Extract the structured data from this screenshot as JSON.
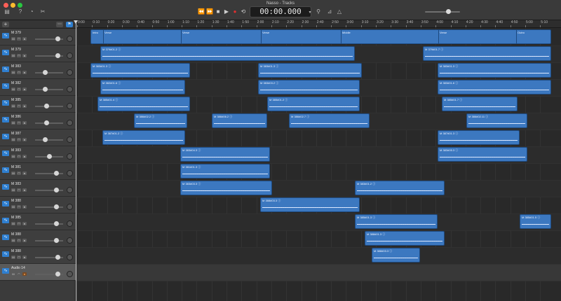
{
  "window": {
    "title": "Nasso - Tracks"
  },
  "toolbar": {
    "time_display": "00:00.000",
    "icons": [
      "library-icon",
      "help-icon",
      "smart-controls-icon",
      "editors-icon",
      "tuner-icon",
      "metronome-icon",
      "count-in-icon",
      "master-volume-icon"
    ],
    "transport": {
      "rewind": "⏪",
      "forward": "⏩",
      "stop": "■",
      "play": "▶",
      "record": "●",
      "cycle": "⟲"
    },
    "master_volume": 0.6
  },
  "headers": {
    "add_label": "+",
    "track_options": "⋯",
    "filter": "⚑"
  },
  "ruler": {
    "labels": [
      "0:00",
      "0:10",
      "0:20",
      "0:30",
      "0:40",
      "0:50",
      "1:00",
      "1:10",
      "1:20",
      "1:30",
      "1:40",
      "1:50",
      "2:00",
      "2:10",
      "2:20",
      "2:30",
      "2:40",
      "2:50",
      "3:00",
      "3:10",
      "3:20",
      "3:30",
      "3:40",
      "3:50",
      "4:00",
      "4:10",
      "4:20",
      "4:30",
      "4:40",
      "4:50",
      "5:00",
      "5:10"
    ]
  },
  "tracks": [
    {
      "name": "M 379",
      "volume": 0.8,
      "selected": false
    },
    {
      "name": "M 379",
      "volume": 0.8,
      "selected": false
    },
    {
      "name": "M 383",
      "volume": 0.35,
      "selected": false
    },
    {
      "name": "M 382",
      "volume": 0.35,
      "selected": false
    },
    {
      "name": "M 385",
      "volume": 0.4,
      "selected": false
    },
    {
      "name": "M 386",
      "volume": 0.4,
      "selected": false
    },
    {
      "name": "M 387",
      "volume": 0.35,
      "selected": false
    },
    {
      "name": "M 383",
      "volume": 0.5,
      "selected": false
    },
    {
      "name": "M 381",
      "volume": 0.75,
      "selected": false
    },
    {
      "name": "M 383",
      "volume": 0.75,
      "selected": false
    },
    {
      "name": "M 388",
      "volume": 0.75,
      "selected": false
    },
    {
      "name": "M 385",
      "volume": 0.75,
      "selected": false
    },
    {
      "name": "M 388",
      "volume": 0.75,
      "selected": false
    },
    {
      "name": "M 388",
      "volume": 0.8,
      "selected": false
    },
    {
      "name": "Audio 14",
      "volume": 0.8,
      "selected": true
    }
  ],
  "regions": [
    {
      "track": 0,
      "start": 0.03,
      "end": 0.215,
      "name": "Intro",
      "sections": [
        "Intro",
        "Verse",
        "Verse",
        "Verse",
        "Middle",
        "Verse",
        "Outro"
      ]
    },
    {
      "track": 1,
      "start": 0.05,
      "end": 0.575,
      "name": "M 379#01.2"
    },
    {
      "track": 1,
      "start": 0.715,
      "end": 0.98,
      "name": "M 379#01.7"
    },
    {
      "track": 2,
      "start": 0.03,
      "end": 0.235,
      "name": "M 383#01.3"
    },
    {
      "track": 2,
      "start": 0.375,
      "end": 0.59,
      "name": "M 383#01.3"
    },
    {
      "track": 2,
      "start": 0.745,
      "end": 0.98,
      "name": "M 383#01.3"
    },
    {
      "track": 3,
      "start": 0.05,
      "end": 0.225,
      "name": "M 382#01.6"
    },
    {
      "track": 3,
      "start": 0.375,
      "end": 0.585,
      "name": "M 383#03.2"
    },
    {
      "track": 3,
      "start": 0.745,
      "end": 0.98,
      "name": "M 383#01.6"
    },
    {
      "track": 4,
      "start": 0.045,
      "end": 0.235,
      "name": "M 385#01.4"
    },
    {
      "track": 4,
      "start": 0.395,
      "end": 0.585,
      "name": "M 385#01.2"
    },
    {
      "track": 4,
      "start": 0.755,
      "end": 0.91,
      "name": "M 385#01.7"
    },
    {
      "track": 5,
      "start": 0.12,
      "end": 0.23,
      "name": "M 386#02.2"
    },
    {
      "track": 5,
      "start": 0.28,
      "end": 0.395,
      "name": "M 386#06.2"
    },
    {
      "track": 5,
      "start": 0.44,
      "end": 0.605,
      "name": "M 386#02.7"
    },
    {
      "track": 5,
      "start": 0.805,
      "end": 0.93,
      "name": "M 386#02.11"
    },
    {
      "track": 6,
      "start": 0.055,
      "end": 0.225,
      "name": "M 387#01.2"
    },
    {
      "track": 6,
      "start": 0.745,
      "end": 0.915,
      "name": "M 387#01.3"
    },
    {
      "track": 7,
      "start": 0.215,
      "end": 0.4,
      "name": "M 383#04.3"
    },
    {
      "track": 7,
      "start": 0.745,
      "end": 0.93,
      "name": "M 383#05.3"
    },
    {
      "track": 8,
      "start": 0.215,
      "end": 0.4,
      "name": "M 381#01.3"
    },
    {
      "track": 9,
      "start": 0.215,
      "end": 0.405,
      "name": "M 383#03.3"
    },
    {
      "track": 9,
      "start": 0.575,
      "end": 0.76,
      "name": "M 383#01.2"
    },
    {
      "track": 10,
      "start": 0.38,
      "end": 0.585,
      "name": "M 388#03.3"
    },
    {
      "track": 11,
      "start": 0.575,
      "end": 0.745,
      "name": "M 385#01.3"
    },
    {
      "track": 11,
      "start": 0.915,
      "end": 0.98,
      "name": "M 385#01.5"
    },
    {
      "track": 12,
      "start": 0.595,
      "end": 0.76,
      "name": "M 388#01.3"
    },
    {
      "track": 13,
      "start": 0.61,
      "end": 0.71,
      "name": "M 388#03.3"
    }
  ],
  "section_markers": [
    {
      "start": 0.03,
      "label": "Intro"
    },
    {
      "start": 0.055,
      "label": "Verse"
    },
    {
      "start": 0.215,
      "label": "Verse"
    },
    {
      "start": 0.38,
      "label": "Verse"
    },
    {
      "start": 0.545,
      "label": "Middle"
    },
    {
      "start": 0.745,
      "label": "Verse"
    },
    {
      "start": 0.905,
      "label": "Outro"
    }
  ],
  "colors": {
    "region": "#3c78c0",
    "region_border": "#1e4a80",
    "selected_track": "#5a5a5a",
    "record": "#e03030",
    "audio_input": "#e08a30"
  }
}
